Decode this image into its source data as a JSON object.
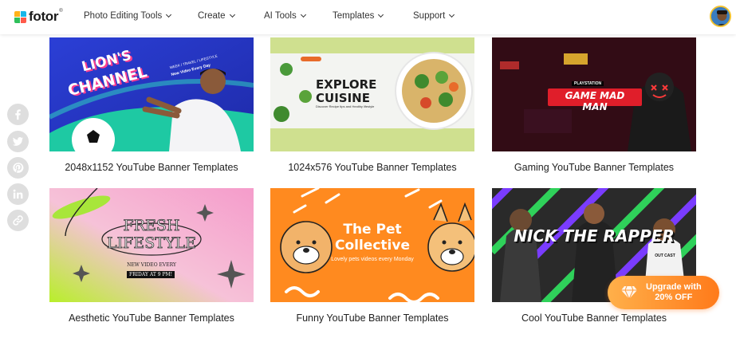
{
  "brand": {
    "name": "fotor",
    "reg": "®"
  },
  "nav": {
    "items": [
      {
        "label": "Photo Editing Tools"
      },
      {
        "label": "Create"
      },
      {
        "label": "AI Tools"
      },
      {
        "label": "Templates"
      },
      {
        "label": "Support"
      }
    ]
  },
  "social": [
    "facebook-icon",
    "twitter-icon",
    "pinterest-icon",
    "linkedin-icon",
    "link-icon"
  ],
  "cards": [
    {
      "caption": "2048x1152 YouTube Banner Templates",
      "art": {
        "title_line1": "LION'S",
        "title_line2": "CHANNEL",
        "tag1": "WEEK / TRAVEL / LIFESTYLE",
        "tag2": "New Video Every Day"
      }
    },
    {
      "caption": "1024x576 YouTube Banner Templates",
      "art": {
        "title_line1": "EXPLORE",
        "title_line2": "CUISINE",
        "sub": "Discover Recipe tips and Healthy lifestyle"
      }
    },
    {
      "caption": "Gaming YouTube Banner Templates",
      "art": {
        "tag": "PLAYSTATION",
        "title": "GAME MAD MAN"
      }
    },
    {
      "caption": "Aesthetic YouTube Banner Templates",
      "art": {
        "title_line1": "FRESH",
        "title_line2": "LIFESTYLE",
        "sub": "NEW VIDEO EVERY",
        "badge": "FRIDAY AT 9 PM!"
      }
    },
    {
      "caption": "Funny YouTube Banner Templates",
      "art": {
        "title_line1": "The Pet",
        "title_line2": "Collective",
        "sub": "Lovely pets videos every Monday"
      }
    },
    {
      "caption": "Cool YouTube Banner Templates",
      "art": {
        "title": "NICK THE RAPPER",
        "shirt": "OUT CAST"
      }
    }
  ],
  "upgrade": {
    "line1": "Upgrade with",
    "line2": "20% OFF"
  },
  "colors": {
    "accent": "#ff8a1f",
    "aesthetic_pink": "#f7a8cf",
    "funny_orange": "#ff8a1f",
    "cuisine_green": "#cfe08f"
  }
}
